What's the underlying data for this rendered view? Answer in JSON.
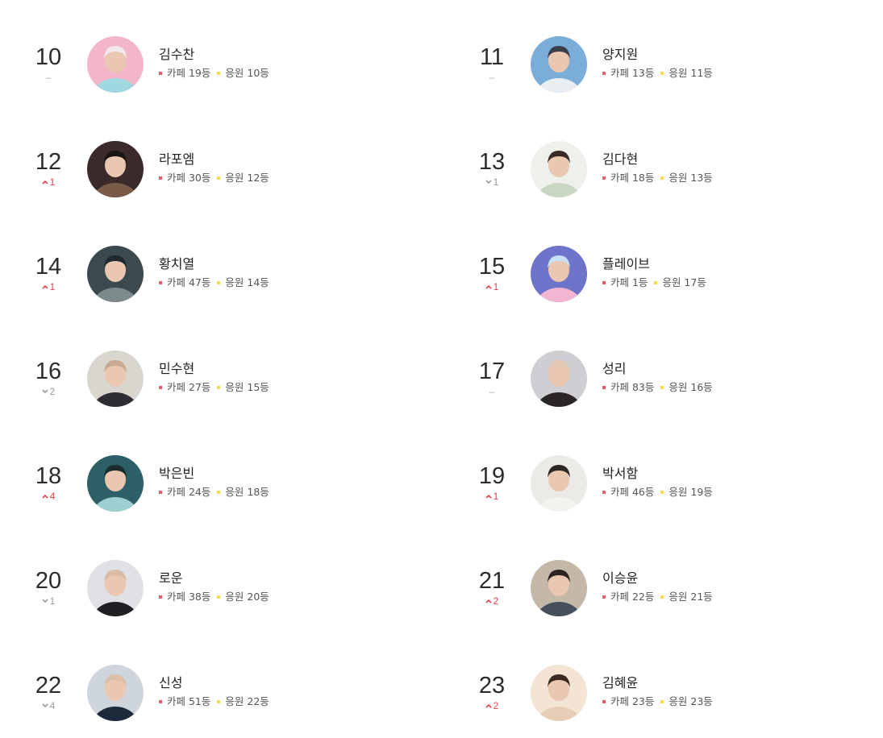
{
  "colors": {
    "up": "#e8404b",
    "down": "#999999",
    "same": "#aaaaaa",
    "cafe_dot": "#ee5a6c",
    "cheer_dot": "#f7da4a"
  },
  "rankings": [
    {
      "rank": "10",
      "change": {
        "dir": "same",
        "text": "–"
      },
      "name": "김수찬",
      "cafe": "카페 19등",
      "cheer": "응원 10등",
      "avatar_colors": [
        "#f3b6c8",
        "#9fd8e0",
        "#f5e9f0"
      ]
    },
    {
      "rank": "11",
      "change": {
        "dir": "same",
        "text": "–"
      },
      "name": "양지원",
      "cafe": "카페 13등",
      "cheer": "응원 11등",
      "avatar_colors": [
        "#7aaed8",
        "#e9eef3",
        "#3b3f4c"
      ]
    },
    {
      "rank": "12",
      "change": {
        "dir": "up",
        "text": "1"
      },
      "name": "라포엠",
      "cafe": "카페 30등",
      "cheer": "응원 12등",
      "avatar_colors": [
        "#3a2a2a",
        "#7a5a48",
        "#1a1414"
      ]
    },
    {
      "rank": "13",
      "change": {
        "dir": "down",
        "text": "1"
      },
      "name": "김다현",
      "cafe": "카페 18등",
      "cheer": "응원 13등",
      "avatar_colors": [
        "#eef0ec",
        "#c9d6c2",
        "#3a2b26"
      ]
    },
    {
      "rank": "14",
      "change": {
        "dir": "up",
        "text": "1"
      },
      "name": "황치열",
      "cafe": "카페 47등",
      "cheer": "응원 14등",
      "avatar_colors": [
        "#3a4a4e",
        "#7d8a8c",
        "#1e2a2d"
      ]
    },
    {
      "rank": "15",
      "change": {
        "dir": "up",
        "text": "1"
      },
      "name": "플레이브",
      "cafe": "카페 1등",
      "cheer": "응원 17등",
      "avatar_colors": [
        "#6d74c9",
        "#f2b6d2",
        "#c8e0f6"
      ]
    },
    {
      "rank": "16",
      "change": {
        "dir": "down",
        "text": "2"
      },
      "name": "민수현",
      "cafe": "카페 27등",
      "cheer": "응원 15등",
      "avatar_colors": [
        "#d9d6cf",
        "#2d2d33",
        "#c8a890"
      ]
    },
    {
      "rank": "17",
      "change": {
        "dir": "same",
        "text": "–"
      },
      "name": "성리",
      "cafe": "카페 83등",
      "cheer": "응원 16등",
      "avatar_colors": [
        "#cfcfd3",
        "#2a2526",
        "#e4c9b7"
      ]
    },
    {
      "rank": "18",
      "change": {
        "dir": "up",
        "text": "4"
      },
      "name": "박은빈",
      "cafe": "카페 24등",
      "cheer": "응원 18등",
      "avatar_colors": [
        "#2c5f66",
        "#9ed0d2",
        "#1b2c2e"
      ]
    },
    {
      "rank": "19",
      "change": {
        "dir": "up",
        "text": "1"
      },
      "name": "박서함",
      "cafe": "카페 46등",
      "cheer": "응원 19등",
      "avatar_colors": [
        "#eceae6",
        "#f4f2ef",
        "#2d2626"
      ]
    },
    {
      "rank": "20",
      "change": {
        "dir": "down",
        "text": "1"
      },
      "name": "로운",
      "cafe": "카페 38등",
      "cheer": "응원 20등",
      "avatar_colors": [
        "#dfe1e4",
        "#1f2024",
        "#d8bca8"
      ]
    },
    {
      "rank": "21",
      "change": {
        "dir": "up",
        "text": "2"
      },
      "name": "이승윤",
      "cafe": "카페 22등",
      "cheer": "응원 21등",
      "avatar_colors": [
        "#c4b8a8",
        "#46505c",
        "#2c2522"
      ]
    },
    {
      "rank": "22",
      "change": {
        "dir": "down",
        "text": "4"
      },
      "name": "신성",
      "cafe": "카페 51등",
      "cheer": "응원 22등",
      "avatar_colors": [
        "#cfd5dc",
        "#1d2a3c",
        "#dbbfa9"
      ]
    },
    {
      "rank": "23",
      "change": {
        "dir": "up",
        "text": "2"
      },
      "name": "김혜윤",
      "cafe": "카페 23등",
      "cheer": "응원 23등",
      "avatar_colors": [
        "#f3e4d4",
        "#e8cdb6",
        "#3a2a22"
      ]
    }
  ]
}
